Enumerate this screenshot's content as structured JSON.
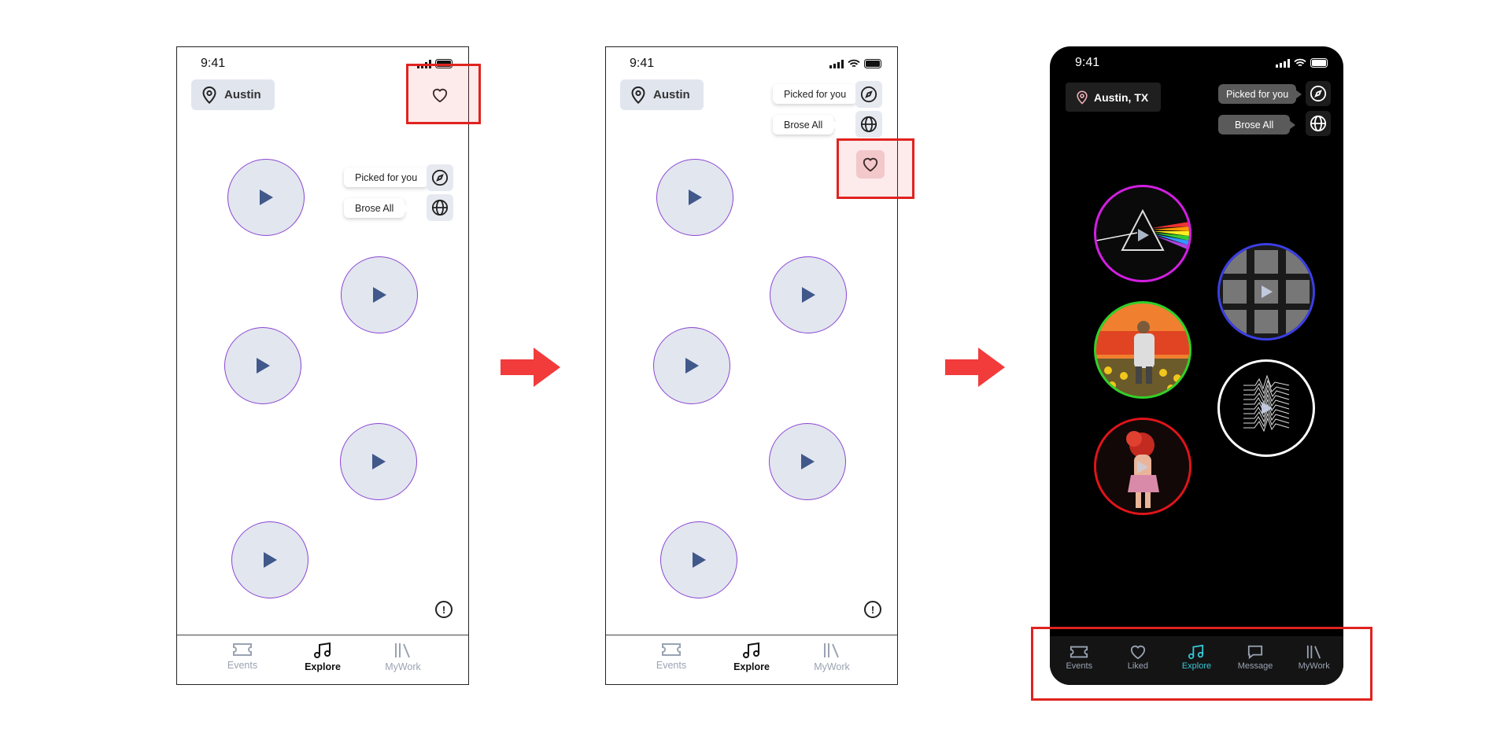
{
  "status": {
    "time": "9:41"
  },
  "wire": {
    "location": "Austin",
    "picked_label": "Picked for you",
    "browse_label": "Brose All",
    "tabs": [
      {
        "label": "Events",
        "icon": "ticket-icon"
      },
      {
        "label": "Explore",
        "icon": "music-note-icon",
        "active": true
      },
      {
        "label": "MyWork",
        "icon": "library-icon"
      }
    ]
  },
  "dark": {
    "location": "Austin, TX",
    "picked_label": "Picked for you",
    "browse_label": "Brose All",
    "tabs": [
      {
        "label": "Events",
        "icon": "ticket-icon"
      },
      {
        "label": "Liked",
        "icon": "heart-icon"
      },
      {
        "label": "Explore",
        "icon": "music-note-icon",
        "active": true
      },
      {
        "label": "Message",
        "icon": "message-icon"
      },
      {
        "label": "MyWork",
        "icon": "library-icon"
      }
    ],
    "album_ring_colors": [
      "#d11fe0",
      "#3b3fe6",
      "#2fd12a",
      "#ffffff",
      "#e0141a"
    ]
  },
  "colors": {
    "highlight": "#e0231f",
    "arrow": "#f23b3b",
    "accent": "#38c6d8",
    "play_ring": "#8b46d2"
  }
}
